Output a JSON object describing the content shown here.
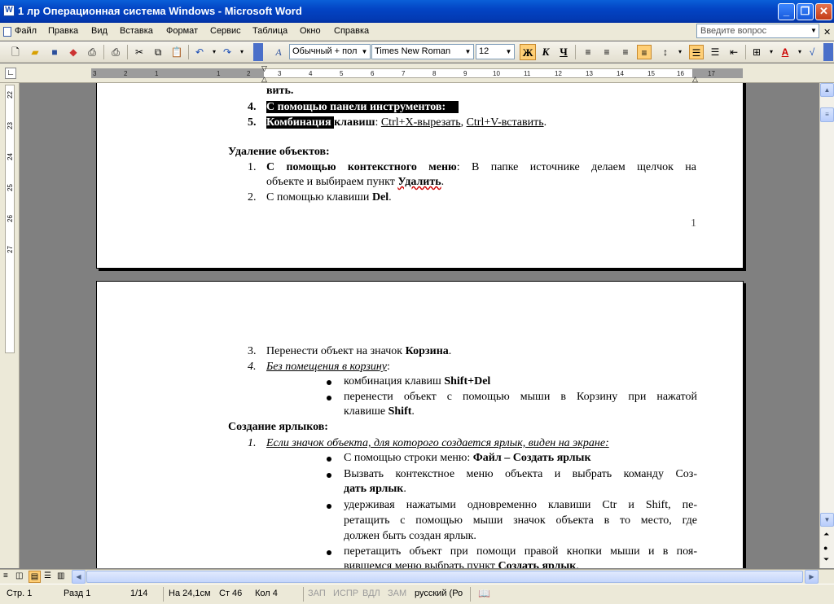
{
  "window": {
    "title": "1 лр Операционная система Windows - Microsoft Word"
  },
  "menu": {
    "items": [
      "Файл",
      "Правка",
      "Вид",
      "Вставка",
      "Формат",
      "Сервис",
      "Таблица",
      "Окно",
      "Справка"
    ],
    "ask_placeholder": "Введите вопрос"
  },
  "toolbar": {
    "style": "Обычный + пол",
    "font": "Times New Roman",
    "size": "12",
    "bold": "Ж",
    "italic": "К",
    "underline": "Ч"
  },
  "ruler": {
    "h_ticks": [
      "3",
      "2",
      "1",
      "1",
      "2",
      "3",
      "4",
      "5",
      "6",
      "7",
      "8",
      "9",
      "10",
      "11",
      "12",
      "13",
      "14",
      "15",
      "16",
      "17"
    ],
    "v_ticks": [
      "22",
      "23",
      "24",
      "25",
      "26",
      "27"
    ]
  },
  "page1": {
    "line_top": "вить.",
    "item4_num": "4.",
    "item4_text": "С помощью панели инструментов:",
    "item5_num": "5.",
    "item5_hl": "Комбинация ",
    "item5_bold": "клавиш",
    "item5_rest_a": ": ",
    "item5_ctrlx": "Ctrl+X-вырезать",
    "item5_sep": ", ",
    "item5_ctrlv": "Ctrl+V-вставить",
    "item5_end": ".",
    "heading_delete": "Удаление объектов:",
    "del1_num": "1.",
    "del1_bold": "С помощью контекстного меню",
    "del1_rest": ": В папке источнике делаем щелчок на",
    "del1_line2a": "объекте и выбираем пункт ",
    "del1_line2_wavy": "Удалить",
    "del1_line2b": ".",
    "del2_num": "2.",
    "del2_text": "С помощью клавиши ",
    "del2_bold": "Del",
    "del2_end": ".",
    "page_number": "1"
  },
  "page2": {
    "item3_num": "3.",
    "item3_text": "Перенести объект на значок ",
    "item3_bold": "Корзина",
    "item3_end": ".",
    "item4_num": "4.",
    "item4_text": "Без помещения в корзину",
    "item4_end": ":",
    "b1_text": "комбинация клавиш ",
    "b1_bold": "Shift+Del",
    "b2_line1": "перенести объект с помощью мыши в Корзину при нажатой",
    "b2_line2a": "клавише ",
    "b2_line2_bold": "Shift",
    "b2_line2_end": ".",
    "heading_shortcut": "Создание ярлыков:",
    "s1_num": "1.",
    "s1_text": "Если значок объекта, для которого создается ярлык, виден на экране:",
    "sb1_text": "С помощью строки меню: ",
    "sb1_bold": "Файл – Создать ярлык",
    "sb2_line1": "Вызвать контекстное меню объекта и выбрать команду Соз-",
    "sb2_line2": "дать ярлык",
    "sb2_end": ".",
    "sb3_line1": "удерживая нажатыми одновременно клавиши Ctr и Shift, пе-",
    "sb3_line2": "ретащить с помощью мыши значок объекта в то место, где",
    "sb3_line3": "должен быть создан ярлык.",
    "sb4_line1": "перетащить объект при помощи правой кнопки мыши и в поя-",
    "sb4_line2a": "вившемся меню выбрать пункт ",
    "sb4_line2_bold": "Создать ярлык",
    "sb4_line2_end": "."
  },
  "status": {
    "page": "Стр. 1",
    "section": "Разд 1",
    "count": "1/14",
    "at": "На 24,1см",
    "line": "Ст 46",
    "col": "Кол 4",
    "rec": "ЗАП",
    "trk": "ИСПР",
    "ext": "ВДЛ",
    "ovr": "ЗАМ",
    "lang": "русский (Ро"
  }
}
